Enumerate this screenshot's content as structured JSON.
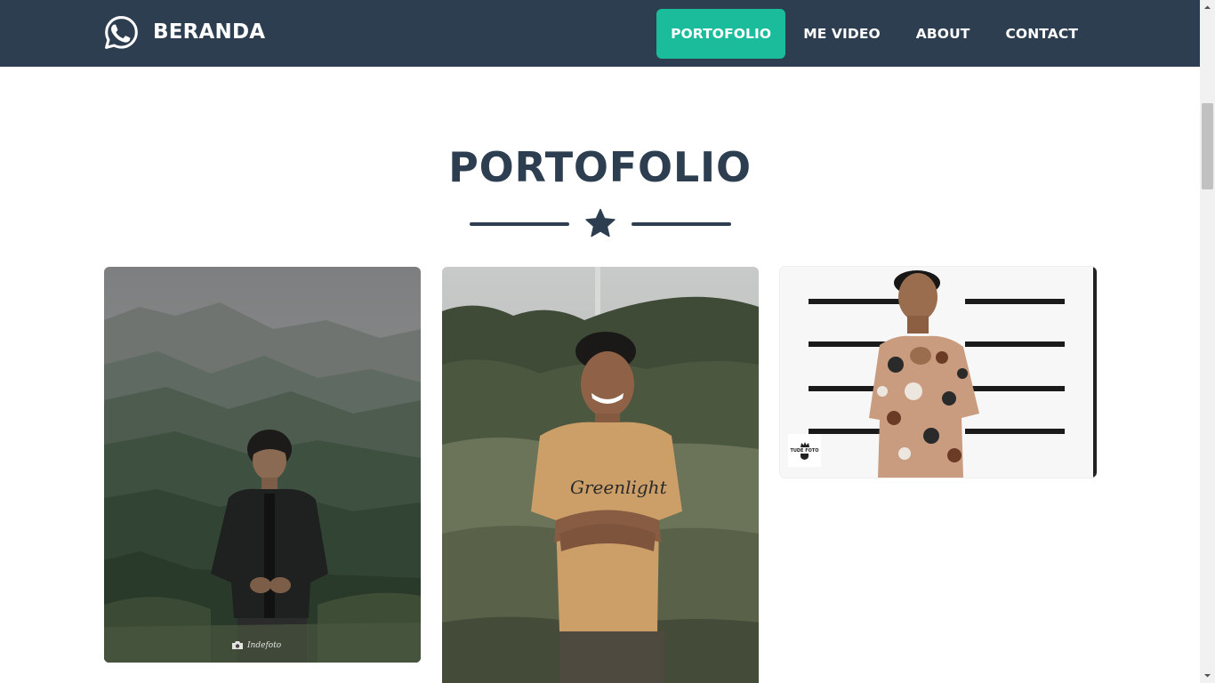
{
  "navbar": {
    "brand": {
      "label": "BERANDA",
      "icon": "whatsapp-icon"
    },
    "links": [
      {
        "label": "PORTOFOLIO",
        "active": true
      },
      {
        "label": "ME VIDEO",
        "active": false
      },
      {
        "label": "ABOUT",
        "active": false
      },
      {
        "label": "CONTACT",
        "active": false
      }
    ]
  },
  "section": {
    "title": "PORTOFOLIO",
    "divider_icon": "star-icon"
  },
  "portfolio": {
    "items": [
      {
        "image": "man in black jacket on misty hillside",
        "watermark": "Indefoto"
      },
      {
        "image": "smiling man in mustard t-shirt in tall grass"
      },
      {
        "image": "man in floral shirt against white striped wall",
        "badge": "TUDE FOTO"
      }
    ]
  },
  "colors": {
    "navbar": "#2c3e50",
    "accent": "#1abc9c",
    "heading": "#2c3e50",
    "background": "#ffffff"
  }
}
